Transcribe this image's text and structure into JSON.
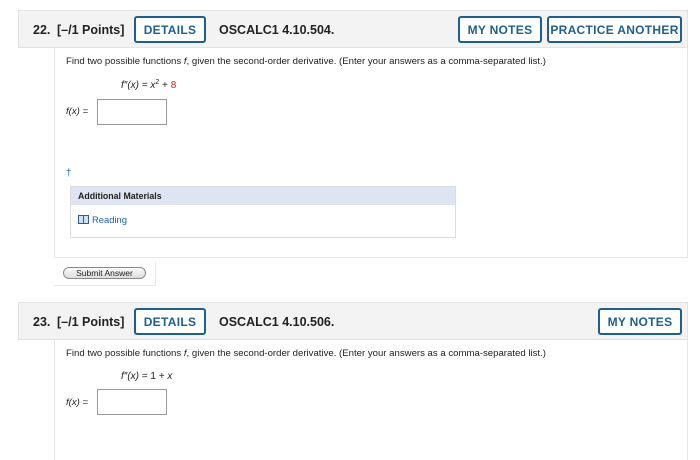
{
  "q22": {
    "number": "22.",
    "points": "[–/1 Points]",
    "details_label": "DETAILS",
    "code": "OSCALC1 4.10.504.",
    "my_notes_label": "MY NOTES",
    "practice_label": "PRACTICE ANOTHER",
    "prompt_a": "Find two possible functions ",
    "prompt_f": "f",
    "prompt_b": ", given the second-order derivative. (Enter your answers as a comma-separated list.)",
    "formula_lhs": "f″(x) = x",
    "formula_exp": "2",
    "formula_plus": " + ",
    "formula_const": "8",
    "answer_label": "f(x) =",
    "answer_value": "",
    "dagger": "†",
    "additional_materials": "Additional Materials",
    "reading": "Reading",
    "submit_label": "Submit Answer"
  },
  "q23": {
    "number": "23.",
    "points": "[–/1 Points]",
    "details_label": "DETAILS",
    "code": "OSCALC1 4.10.506.",
    "my_notes_label": "MY NOTES",
    "prompt_a": "Find two possible functions ",
    "prompt_f": "f",
    "prompt_b": ", given the second-order derivative. (Enter your answers as a comma-separated list.)",
    "formula_lhs": "f″(x) = ",
    "formula_rhs_a": "1",
    "formula_rhs_b": " + x",
    "answer_label": "f(x) =",
    "answer_value": ""
  },
  "colors": {
    "accent": "#1f5f8b",
    "constant_red": "#c0211b",
    "link": "#1f5fa3",
    "header_bg": "#f3f3f3",
    "materials_bg": "#dfe4f3"
  },
  "icons": {
    "reading": "book-icon"
  }
}
